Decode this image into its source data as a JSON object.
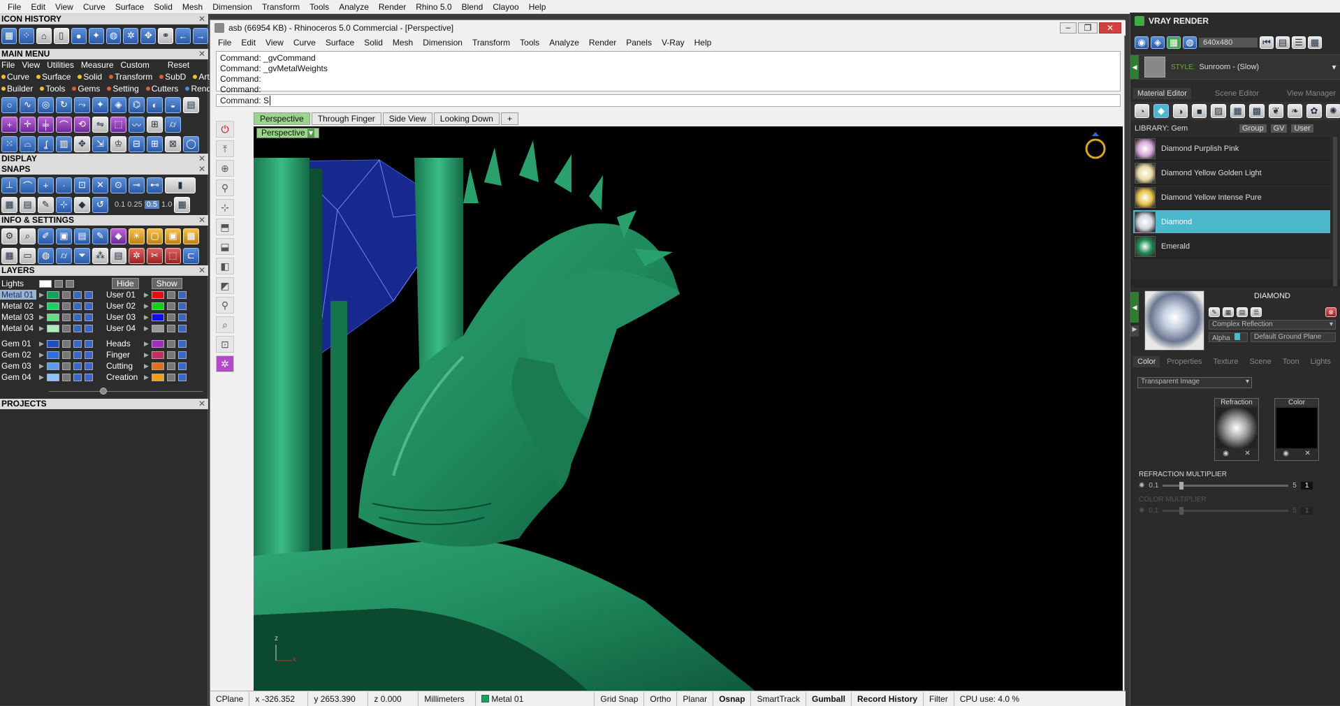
{
  "top_menu": [
    "File",
    "Edit",
    "View",
    "Curve",
    "Surface",
    "Solid",
    "Mesh",
    "Dimension",
    "Transform",
    "Tools",
    "Analyze",
    "Render",
    "Rhino 5.0",
    "Blend",
    "Clayoo",
    "Help"
  ],
  "left_panel": {
    "icon_history_title": "ICON HISTORY",
    "main_menu_title": "MAIN MENU",
    "main_menu_row1": [
      "File",
      "View",
      "Utilities",
      "Measure",
      "Custom",
      "Reset"
    ],
    "main_menu_row2": [
      "Curve",
      "Surface",
      "Solid",
      "Transform",
      "SubD",
      "Art"
    ],
    "main_menu_row3": [
      "Builder",
      "Tools",
      "Gems",
      "Setting",
      "Cutters",
      "Render"
    ],
    "display_title": "DISPLAY",
    "snaps_title": "SNAPS",
    "snap_values": [
      "0.1",
      "0.25",
      "0.5",
      "1.0"
    ],
    "info_title": "INFO & SETTINGS",
    "layers_title": "LAYERS",
    "lights_label": "Lights",
    "hide_label": "Hide",
    "show_label": "Show",
    "layers_left": [
      {
        "name": "Metal 01",
        "color": "#16a05a"
      },
      {
        "name": "Metal 02",
        "color": "#22cc66"
      },
      {
        "name": "Metal 03",
        "color": "#66dd88"
      },
      {
        "name": "Metal 04",
        "color": "#aaeebb"
      },
      {
        "name": "Gem 01",
        "color": "#1b4fc2"
      },
      {
        "name": "Gem 02",
        "color": "#2b6fe0"
      },
      {
        "name": "Gem 03",
        "color": "#5a9bf0"
      },
      {
        "name": "Gem 04",
        "color": "#8fc0ff"
      }
    ],
    "layers_right": [
      {
        "name": "User 01",
        "color": "#e01010"
      },
      {
        "name": "User 02",
        "color": "#10d010"
      },
      {
        "name": "User 03",
        "color": "#1010e0"
      },
      {
        "name": "User 04",
        "color": "#999999"
      },
      {
        "name": "Heads",
        "color": "#9a2fc0"
      },
      {
        "name": "Finger",
        "color": "#c0305a"
      },
      {
        "name": "Cutting",
        "color": "#e07020"
      },
      {
        "name": "Creation",
        "color": "#f0a020"
      }
    ],
    "projects_title": "PROJECTS"
  },
  "main_window": {
    "title": "asb (66954 KB) - Rhinoceros 5.0 Commercial - [Perspective]",
    "menu": [
      "File",
      "Edit",
      "View",
      "Curve",
      "Surface",
      "Solid",
      "Mesh",
      "Dimension",
      "Transform",
      "Tools",
      "Analyze",
      "Render",
      "Panels",
      "V-Ray",
      "Help"
    ],
    "command_history": [
      "Command: _gvCommand",
      "Command: _gvMetalWeights",
      "Command:",
      "Command:"
    ],
    "command_prompt": "Command: S",
    "viewport_tabs": [
      "Perspective",
      "Through Finger",
      "Side View",
      "Looking Down"
    ],
    "viewport_label": "Perspective",
    "axis_z": "z",
    "axis_x": "x"
  },
  "status_bar": {
    "cplane": "CPlane",
    "x": "x -326.352",
    "y": "y 2653.390",
    "z": "z 0.000",
    "units": "Millimeters",
    "layer": "Metal 01",
    "grid_snap": "Grid Snap",
    "ortho": "Ortho",
    "planar": "Planar",
    "osnap": "Osnap",
    "smarttrack": "SmartTrack",
    "gumball": "Gumball",
    "record_history": "Record History",
    "filter": "Filter",
    "cpu": "CPU use: 4.0 %"
  },
  "right_panel": {
    "title": "VRAY RENDER",
    "resolution": "640x480",
    "style_label": "STYLE:",
    "style_value": "Sunroom - (Slow)",
    "tabs": [
      "Material Editor",
      "Scene Editor",
      "View Manager"
    ],
    "library_label": "LIBRARY: Gem",
    "group_label": "Group",
    "gv_label": "GV",
    "user_label": "User",
    "materials": [
      {
        "name": "Diamond Purplish Pink",
        "color": "#d8a9d8"
      },
      {
        "name": "Diamond Yellow Golden Light",
        "color": "#e8d9a0"
      },
      {
        "name": "Diamond Yellow Intense Pure",
        "color": "#e8c24a"
      },
      {
        "name": "Diamond",
        "color": "#d0d6e0"
      },
      {
        "name": "Emerald",
        "color": "#1e8a55"
      }
    ],
    "selected_material": "DIAMOND",
    "reflection": "Complex Reflection",
    "alpha_label": "Alpha",
    "ground_plane": "Default Ground Plane",
    "sub_tabs": [
      "Color",
      "Properties",
      "Texture",
      "Scene",
      "Toon",
      "Lights"
    ],
    "color_mode": "Transparent Image",
    "refraction_label": "Refraction",
    "color_label": "Color",
    "refraction_multiplier": "REFRACTION MULTIPLIER",
    "color_multiplier": "COLOR MULTIPLIER",
    "slider_min": "0.1",
    "slider_max": "5",
    "slider_value": "1"
  },
  "colors": {
    "model_green": "#1f8a5c",
    "tab_active": "#9bd48d",
    "material_selected": "#4cb8cb"
  }
}
